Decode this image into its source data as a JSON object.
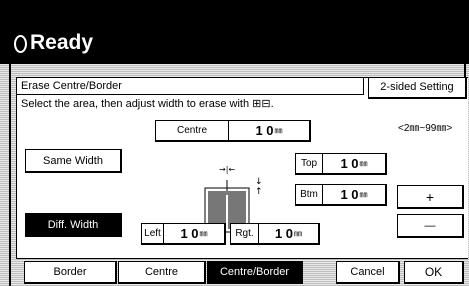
{
  "status": {
    "title": "Ready"
  },
  "panel": {
    "title": "Erase Centre/Border",
    "instruction": "Select the area, then adjust width to erase with ⊞⊟.",
    "range": "<2㎜~99㎜>"
  },
  "buttons": {
    "two_sided": "2-sided Setting",
    "same_width": "Same Width",
    "diff_width": "Diff. Width",
    "plus": "+",
    "minus": "—"
  },
  "fields": {
    "centre": {
      "label": "Centre",
      "value": "1 0",
      "unit": "㎜"
    },
    "top": {
      "label": "Top",
      "value": "1 0",
      "unit": "㎜"
    },
    "btm": {
      "label": "Btm",
      "value": "1 0",
      "unit": "㎜"
    },
    "left": {
      "label": "Left",
      "value": "1 0",
      "unit": "㎜"
    },
    "rgt": {
      "label": "Rgt.",
      "value": "1 0",
      "unit": "㎜"
    }
  },
  "bottom_tabs": [
    {
      "label": "Border",
      "selected": false
    },
    {
      "label": "Centre",
      "selected": false
    },
    {
      "label": "Centre/Border",
      "selected": true
    }
  ],
  "bottom_actions": {
    "cancel": "Cancel",
    "ok": "OK"
  }
}
